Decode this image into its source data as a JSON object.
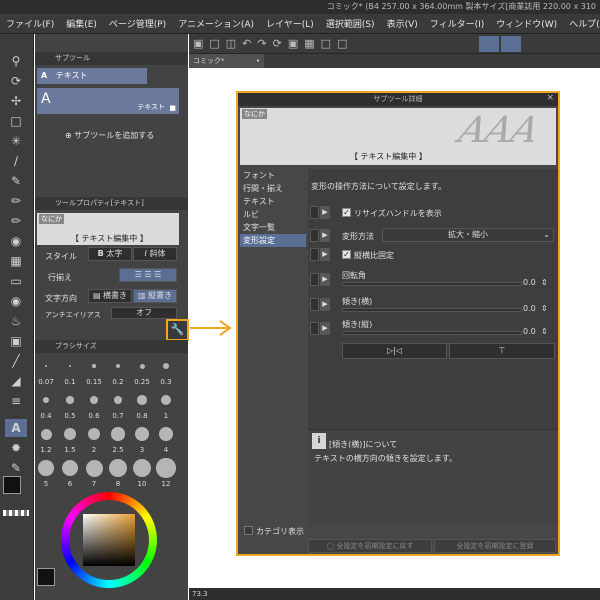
{
  "window": {
    "title": "コミック* (B4 257.00 x 364.00mm 製本サイズ[商業誌用 220.00 x 310"
  },
  "menu": [
    "ファイル(F)",
    "編集(E)",
    "ページ管理(P)",
    "アニメーション(A)",
    "レイヤー(L)",
    "選択範囲(S)",
    "表示(V)",
    "フィルター(I)",
    "ウィンドウ(W)",
    "ヘルプ(H)"
  ],
  "colors": {
    "accent": "#f2a51e",
    "selection": "#5b6f95"
  },
  "subtool": {
    "header": "サブツール",
    "items": [
      {
        "label": "テキスト",
        "icon": "text-A-icon"
      },
      {
        "label": "テキスト",
        "icon": "text-A-icon"
      }
    ],
    "add_label": "サブツールを追加する"
  },
  "toolprop": {
    "header": "ツールプロパティ[テキスト]",
    "preview_tag": "なにか",
    "preview_text": "【 テキスト編集中 】",
    "style_label": "スタイル",
    "bold_label": "太字",
    "italic_label": "斜体",
    "align_label": "行揃え",
    "direction_label": "文字方向",
    "horizontal_label": "横書き",
    "vertical_label": "縦書き",
    "antialias_label": "アンチエイリアス",
    "antialias_value": "オフ"
  },
  "brushsize": {
    "header": "ブラシサイズ",
    "sizes": [
      "0.07",
      "0.1",
      "0.15",
      "0.2",
      "0.25",
      "0.3",
      "0.4",
      "0.5",
      "0.6",
      "0.7",
      "0.8",
      "1",
      "1.2",
      "1.5",
      "2",
      "2.5",
      "3",
      "4",
      "5",
      "6",
      "7",
      "8",
      "10",
      "12"
    ]
  },
  "canvas": {
    "tab": "コミック*",
    "status": "73.3"
  },
  "dialog": {
    "title": "サブツール詳細",
    "preview_tag": "なにか",
    "preview_text": "【 テキスト編集中 】",
    "preview_watermark": "AAA",
    "categories": [
      "フォント",
      "行間・揃え",
      "テキスト",
      "ルビ",
      "文字一覧",
      "変形設定"
    ],
    "selected_category": "変形設定",
    "description": "変形の操作方法について設定します。",
    "resize_handle_label": "リサイズハンドルを表示",
    "transform_label": "変形方法",
    "transform_value": "拡大・縮小",
    "keep_ratio_label": "縦横比固定",
    "rotation_label": "回転角",
    "rotation_value": "0.0",
    "skew_h_label": "傾き(横)",
    "skew_h_value": "0.0",
    "skew_v_label": "傾き(縦)",
    "skew_v_value": "0.0",
    "info_title": "[傾き(横)]について",
    "info_body": "テキストの横方向の傾きを設定します。",
    "show_category_label": "カテゴリ表示",
    "reset_all_label": "全設定を初期設定に戻す",
    "register_all_label": "全設定を初期設定に登録"
  }
}
